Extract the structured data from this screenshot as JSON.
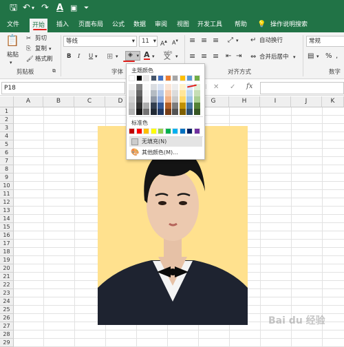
{
  "titlebar": {
    "save_icon": "save-icon",
    "undo_icon": "undo-icon",
    "redo_icon": "redo-icon",
    "font_color_icon": "font-color-icon",
    "format_icon": "format-icon",
    "customize_icon": "customize-icon"
  },
  "tabs": [
    "文件",
    "开始",
    "插入",
    "页面布局",
    "公式",
    "数据",
    "审阅",
    "视图",
    "开发工具",
    "帮助"
  ],
  "tell_me": "操作说明搜索",
  "clipboard": {
    "paste": "粘贴",
    "cut": "剪切",
    "copy": "复制",
    "format_painter": "格式刷",
    "group": "剪贴板"
  },
  "font": {
    "name": "等线",
    "size": "11",
    "bold": "B",
    "italic": "I",
    "underline": "U",
    "font_color_letter": "A",
    "font_glyph": "wén",
    "group": "字体"
  },
  "alignment": {
    "wrap": "自动换行",
    "merge": "合并后居中",
    "group": "对齐方式"
  },
  "number": {
    "format": "常规",
    "percent": "%",
    "group": "数字"
  },
  "formula_bar": {
    "namebox": "P18",
    "cancel": "✕",
    "enter": "✓",
    "fx": "fx"
  },
  "columns": [
    "A",
    "B",
    "C",
    "D",
    "E",
    "F",
    "G",
    "H",
    "I",
    "J",
    "K"
  ],
  "rows": [
    "1",
    "2",
    "3",
    "4",
    "5",
    "6",
    "7",
    "8",
    "9",
    "10",
    "11",
    "12",
    "13",
    "14",
    "15",
    "16",
    "17",
    "18",
    "19",
    "20",
    "21",
    "22",
    "23",
    "24",
    "25",
    "26",
    "27",
    "28",
    "29"
  ],
  "popup": {
    "theme_colors_label": "主题颜色",
    "standard_colors_label": "标准色",
    "no_fill": "无填充(N)",
    "more_colors": "其他颜色(M)...",
    "theme_top": [
      "#ffffff",
      "#000000",
      "#e7e6e6",
      "#44546a",
      "#4472c4",
      "#ed7d31",
      "#a5a5a5",
      "#ffc000",
      "#5b9bd5",
      "#70ad47"
    ],
    "standard": [
      "#c00000",
      "#ff0000",
      "#ffc000",
      "#ffff00",
      "#92d050",
      "#00b050",
      "#00b0f0",
      "#0070c0",
      "#002060",
      "#7030a0"
    ]
  },
  "photo": {
    "background": "#ffe18e"
  },
  "watermark": "Bai du 经验"
}
